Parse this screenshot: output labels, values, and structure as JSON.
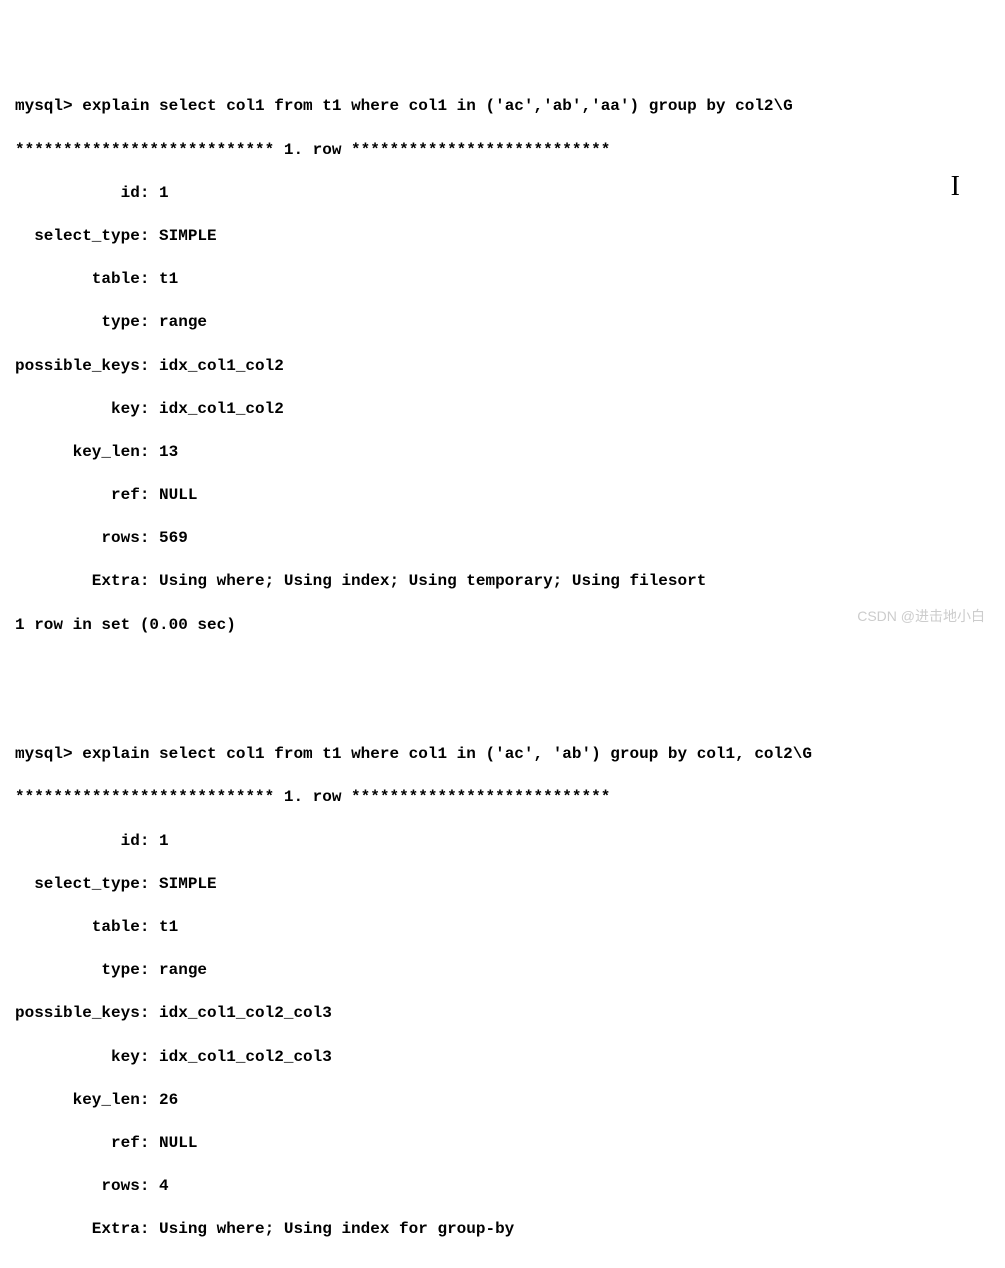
{
  "block1": {
    "prompt": "mysql> ",
    "query": "explain select col1 from t1 where col1 in ('ac','ab','aa') group by col2\\G",
    "separator": "*************************** 1. row ***************************",
    "fields": {
      "id_label": "id",
      "id": "1",
      "select_type_label": "select_type",
      "select_type": "SIMPLE",
      "table_label": "table",
      "table": "t1",
      "type_label": "type",
      "type": "range",
      "possible_keys_label": "possible_keys",
      "possible_keys": "idx_col1_col2",
      "key_label": "key",
      "key": "idx_col1_col2",
      "key_len_label": "key_len",
      "key_len": "13",
      "ref_label": "ref",
      "ref": "NULL",
      "rows_label": "rows",
      "rows": "569",
      "extra_label": "Extra",
      "extra": "Using where; Using index; Using temporary; Using filesort"
    },
    "footer": "1 row in set (0.00 sec)"
  },
  "block2": {
    "prompt": "mysql> ",
    "query": "explain select col1 from t1 where col1 in ('ac', 'ab') group by col1, col2\\G",
    "separator": "*************************** 1. row ***************************",
    "fields": {
      "id_label": "id",
      "id": "1",
      "select_type_label": "select_type",
      "select_type": "SIMPLE",
      "table_label": "table",
      "table": "t1",
      "type_label": "type",
      "type": "range",
      "possible_keys_label": "possible_keys",
      "possible_keys": "idx_col1_col2_col3",
      "key_label": "key",
      "key": "idx_col1_col2_col3",
      "key_len_label": "key_len",
      "key_len": "26",
      "ref_label": "ref",
      "ref": "NULL",
      "rows_label": "rows",
      "rows": "4",
      "extra_label": "Extra",
      "extra": "Using where; Using index for group-by"
    }
  },
  "cursor": "I",
  "watermark": "CSDN @进击地小白"
}
